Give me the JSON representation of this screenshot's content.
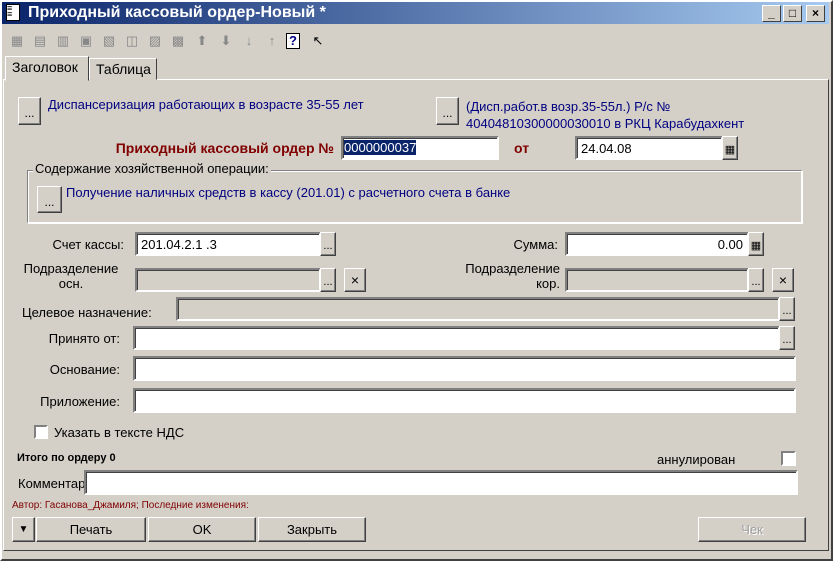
{
  "window": {
    "title": "Приходный кассовый ордер-Новый *",
    "controls": [
      "_",
      "□",
      "×"
    ]
  },
  "toolbar": {
    "icons": [
      "▦",
      "▤",
      "▥",
      "▣",
      "▧",
      "◫",
      "▨",
      "▩",
      "⬆",
      "⬇",
      "↓",
      "↑",
      "?",
      "↖"
    ]
  },
  "tabs": [
    {
      "label": "Заголовок"
    },
    {
      "label": "Таблица"
    }
  ],
  "form": {
    "ellipsis": "...",
    "program": "Диспансеризация работающих в возрасте 35-55 лет",
    "account_line1": "(Дисп.работ.в возр.35-55л.) Р/с №",
    "account_line2": "40404810300000030010 в РКЦ Карабудахкент",
    "order_label": "Приходный кассовый ордер №",
    "order_number": "0000000037",
    "from_label": "от",
    "date": "24.04.08",
    "operation_group": "Содержание хозяйственной операции:",
    "operation": "Получение наличных средств в кассу (201.01) с расчетного счета в банке",
    "cash_account_label": "Счет кассы:",
    "cash_account": "201.04.2.1 .3",
    "sum_label": "Сумма:",
    "sum": "0.00",
    "dept_main_label1": "Подразделение",
    "dept_main_label2": "осн.",
    "dept_corr_label1": "Подразделение",
    "dept_corr_label2": "кор.",
    "clear": "×",
    "purpose_label": "Целевое назначение:",
    "received_from_label": "Принято от:",
    "basis_label": "Основание:",
    "attachment_label": "Приложение:",
    "vat_label": "Указать в тексте НДС",
    "total": "Итого по ордеру 0",
    "cancelled_label": "аннулирован",
    "comment_label": "Комментарий:",
    "author": "Автор: Гасанова_Джамиля; Последние изменения:"
  },
  "buttons": {
    "menu": "▼",
    "print": "Печать",
    "ok": "OK",
    "close": "Закрыть",
    "receipt": "Чек"
  }
}
